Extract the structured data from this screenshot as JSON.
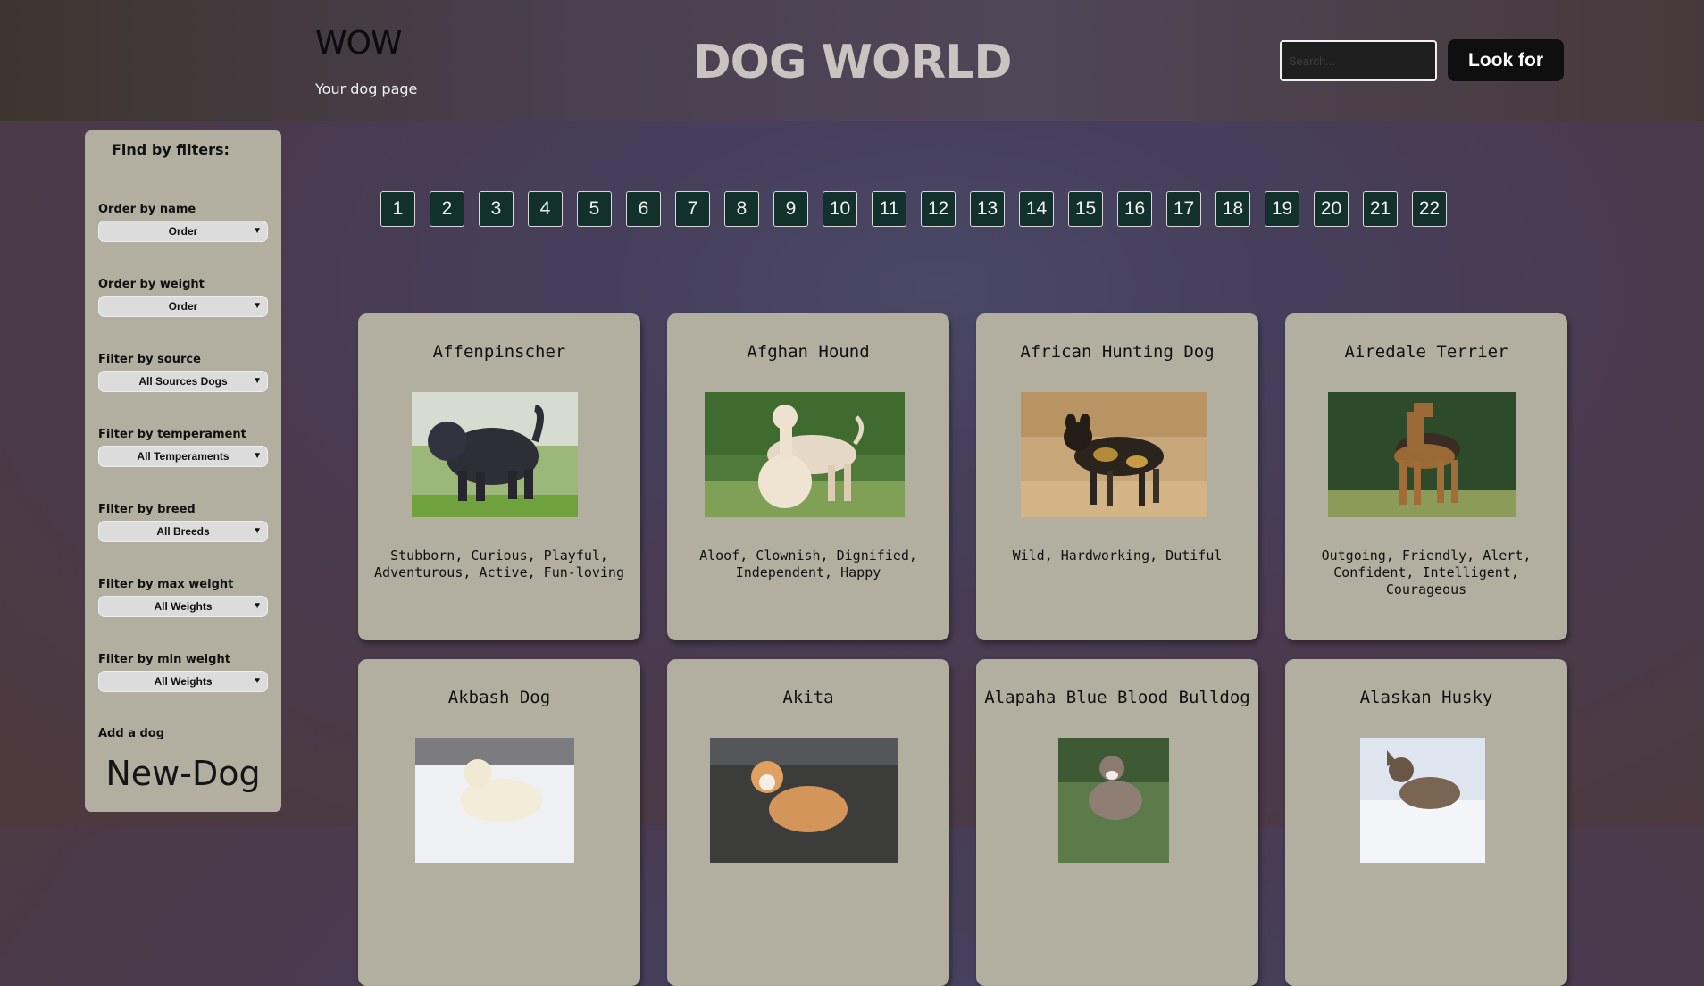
{
  "header": {
    "logo": "WOW",
    "tagline": "Your dog page",
    "title": "DOG WORLD",
    "search_placeholder": "Search...",
    "search_button": "Look for"
  },
  "sidebar": {
    "title": "Find by filters:",
    "filters": [
      {
        "label": "Order by name",
        "selected": "Order"
      },
      {
        "label": "Order by weight",
        "selected": "Order"
      },
      {
        "label": "Filter by source",
        "selected": "All Sources Dogs"
      },
      {
        "label": "Filter by temperament",
        "selected": "All Temperaments"
      },
      {
        "label": "Filter by breed",
        "selected": "All Breeds"
      },
      {
        "label": "Filter by max weight",
        "selected": "All Weights"
      },
      {
        "label": "Filter by min weight",
        "selected": "All Weights"
      }
    ],
    "add_label": "Add a dog",
    "add_link": "New-Dog"
  },
  "pagination": [
    "1",
    "2",
    "3",
    "4",
    "5",
    "6",
    "7",
    "8",
    "9",
    "10",
    "11",
    "12",
    "13",
    "14",
    "15",
    "16",
    "17",
    "18",
    "19",
    "20",
    "21",
    "22"
  ],
  "dogs": [
    {
      "name": "Affenpinscher",
      "temperament": "Stubborn, Curious, Playful, Adventurous, Active, Fun-loving"
    },
    {
      "name": "Afghan Hound",
      "temperament": "Aloof, Clownish, Dignified, Independent, Happy"
    },
    {
      "name": "African Hunting Dog",
      "temperament": "Wild, Hardworking, Dutiful"
    },
    {
      "name": "Airedale Terrier",
      "temperament": "Outgoing, Friendly, Alert, Confident, Intelligent, Courageous"
    },
    {
      "name": "Akbash Dog",
      "temperament": ""
    },
    {
      "name": "Akita",
      "temperament": ""
    },
    {
      "name": "Alapaha Blue Blood Bulldog",
      "temperament": ""
    },
    {
      "name": "Alaskan Husky",
      "temperament": ""
    }
  ]
}
